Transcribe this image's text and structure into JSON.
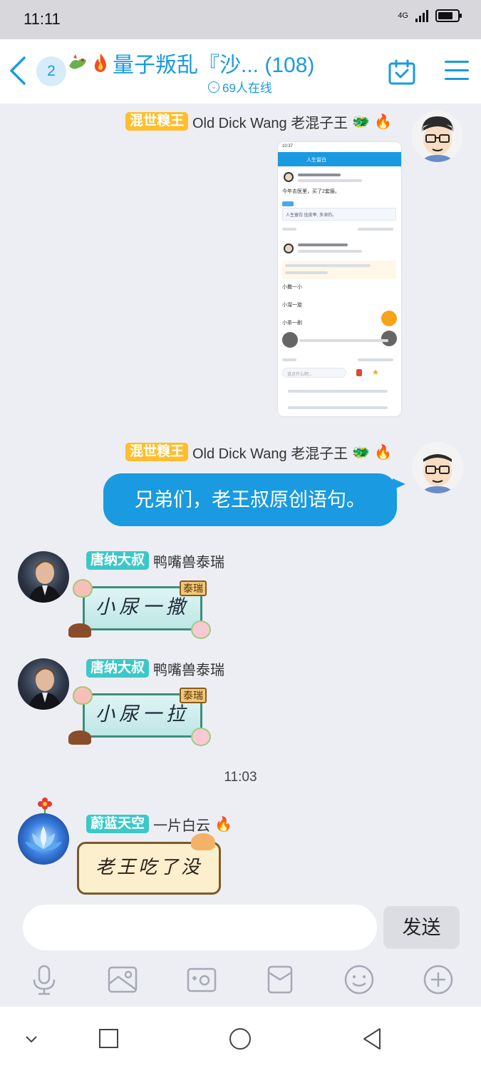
{
  "status": {
    "time": "11:11",
    "network": "4G"
  },
  "header": {
    "unread": "2",
    "title": "量子叛乱『沙... (108)",
    "online": "69人在线"
  },
  "messages": [
    {
      "tag": "混世糗王",
      "name": "Old Dick Wang 老混子王"
    },
    {
      "tag": "混世糗王",
      "name": "Old Dick Wang 老混子王",
      "text": "兄弟们，老王叔原创语句。"
    },
    {
      "tag": "唐纳大叔",
      "name": "鸭嘴兽泰瑞",
      "sticker_text": "小尿一撒",
      "sign": "泰瑞"
    },
    {
      "tag": "唐纳大叔",
      "name": "鸭嘴兽泰瑞",
      "sticker_text": "小尿一拉",
      "sign": "泰瑞"
    },
    {
      "tag": "蔚蓝天空",
      "name": "一片白云",
      "sticker_text": "老王吃了没"
    }
  ],
  "time_separator": "11:03",
  "screenshot_mock": {
    "time": "10:37",
    "group_name": "人生留白",
    "post_text": "今年去医里，买了2套服。",
    "quote": "人生留白 挂皮率, 多深的。",
    "lines": [
      "小撒一小",
      "小溜一旋",
      "小茶一剧"
    ],
    "reply_placeholder": "说点什么吧..."
  },
  "input": {
    "placeholder": "",
    "send_label": "发送"
  },
  "colors": {
    "accent": "#1a9ae0",
    "orange_tag": "#ffbe2e",
    "teal_tag": "#3cc8c8"
  }
}
